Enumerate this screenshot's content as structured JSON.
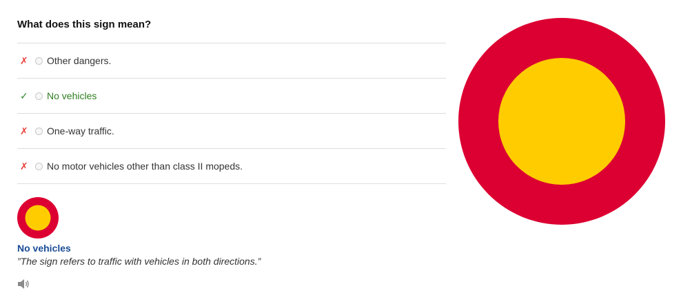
{
  "question": "What does this sign mean?",
  "options": [
    {
      "mark": "✗",
      "label": "Other dangers."
    },
    {
      "mark": "✓",
      "label": "No vehicles"
    },
    {
      "mark": "✗",
      "label": "One-way traffic."
    },
    {
      "mark": "✗",
      "label": "No motor vehicles other than class II mopeds."
    }
  ],
  "answer": {
    "title": "No vehicles",
    "explanation": "”The sign refers to traffic with vehicles in both directions.”"
  },
  "sign": {
    "outer_color": "#dc0032",
    "inner_color": "#ffcc00"
  },
  "icons": {
    "audio": "speaker-icon"
  }
}
